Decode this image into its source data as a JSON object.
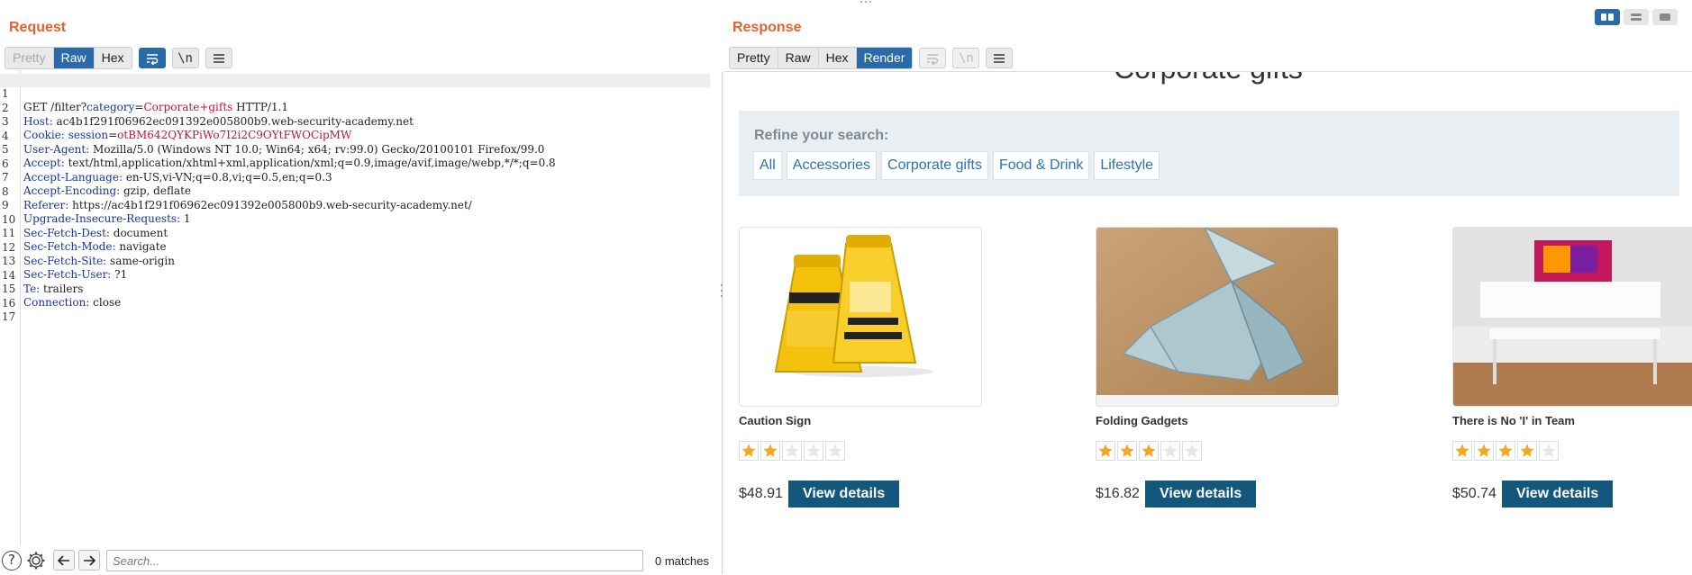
{
  "request": {
    "title": "Request",
    "tabs": [
      "Pretty",
      "Raw",
      "Hex"
    ],
    "wrap_icon": "wrap-lines-icon",
    "newline_label": "\\n",
    "menu_icon": "hamburger-menu-icon",
    "line_numbers": [
      "1",
      "2",
      "3",
      "4",
      "5",
      "6",
      "7",
      "8",
      "9",
      "10",
      "11",
      "12",
      "13",
      "14",
      "15",
      "16",
      "17"
    ],
    "line1": {
      "method": "GET /filter?",
      "pk": "category",
      "eq": "=",
      "pv": "Corporate+gifts",
      "tail": " HTTP/1.1"
    },
    "headers": [
      {
        "k": "Host:",
        "v": " ac4b1f291f06962ec091392e005800b9.web-security-academy.net"
      },
      {
        "k": "Cookie:",
        "v": " ",
        "ck": "session",
        "ceq": "=",
        "cv": "otBM642QYKPiWo7I2i2C9OYtFWOCipMW"
      },
      {
        "k": "User-Agent:",
        "v": " Mozilla/5.0 (Windows NT 10.0; Win64; x64; rv:99.0) Gecko/20100101 Firefox/99.0"
      },
      {
        "k": "Accept:",
        "v": " text/html,application/xhtml+xml,application/xml;q=0.9,image/avif,image/webp,*/*;q=0.8"
      },
      {
        "k": "Accept-Language:",
        "v": " en-US,vi-VN;q=0.8,vi;q=0.5,en;q=0.3"
      },
      {
        "k": "Accept-Encoding:",
        "v": " gzip, deflate"
      },
      {
        "k": "Referer:",
        "v": " https://ac4b1f291f06962ec091392e005800b9.web-security-academy.net/"
      },
      {
        "k": "Upgrade-Insecure-Requests:",
        "v": " 1"
      },
      {
        "k": "Sec-Fetch-Dest:",
        "v": " document"
      },
      {
        "k": "Sec-Fetch-Mode:",
        "v": " navigate"
      },
      {
        "k": "Sec-Fetch-Site:",
        "v": " same-origin"
      },
      {
        "k": "Sec-Fetch-User:",
        "v": " ?1"
      },
      {
        "k": "Te:",
        "v": " trailers"
      },
      {
        "k": "Connection:",
        "v": " close"
      }
    ]
  },
  "search": {
    "placeholder": "Search...",
    "matches": "0 matches"
  },
  "response": {
    "title": "Response",
    "tabs": [
      "Pretty",
      "Raw",
      "Hex",
      "Render"
    ],
    "heading_partial": "Corporate gifts",
    "refine_label": "Refine your search:",
    "filters": [
      "All",
      "Accessories",
      "Corporate gifts",
      "Food & Drink",
      "Lifestyle"
    ],
    "products": [
      {
        "name": "Caution Sign",
        "rating": 2,
        "price": "$48.91",
        "button": "View details"
      },
      {
        "name": "Folding Gadgets",
        "rating": 3,
        "price": "$16.82",
        "button": "View details"
      },
      {
        "name": "There is No 'I' in Team",
        "rating": 4,
        "price": "$50.74",
        "button": "View details"
      }
    ]
  },
  "colors": {
    "accent": "#e8612c",
    "active_tab": "#2b6aa8",
    "star": "#f5a623",
    "button": "#13577d",
    "link": "#2a74b5"
  }
}
